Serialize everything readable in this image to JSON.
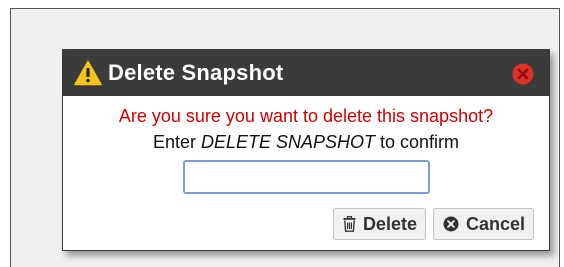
{
  "dialog": {
    "title": "Delete Snapshot",
    "question": "Are you sure you want to delete this snapshot?",
    "instruction_prefix": "Enter ",
    "instruction_keyword": "DELETE SNAPSHOT",
    "instruction_suffix": " to confirm",
    "confirm_input": {
      "value": "",
      "placeholder": ""
    },
    "delete_label": "Delete",
    "cancel_label": "Cancel"
  },
  "icons": {
    "title": "warning-icon",
    "close": "close-icon",
    "delete": "trash-icon",
    "cancel": "cancel-icon"
  },
  "colors": {
    "titlebar": "#3b3b3b",
    "question_text": "#d10000",
    "warning_icon": "#f5c518",
    "close_icon": "#e0302a",
    "input_border": "#7a9fd6"
  }
}
